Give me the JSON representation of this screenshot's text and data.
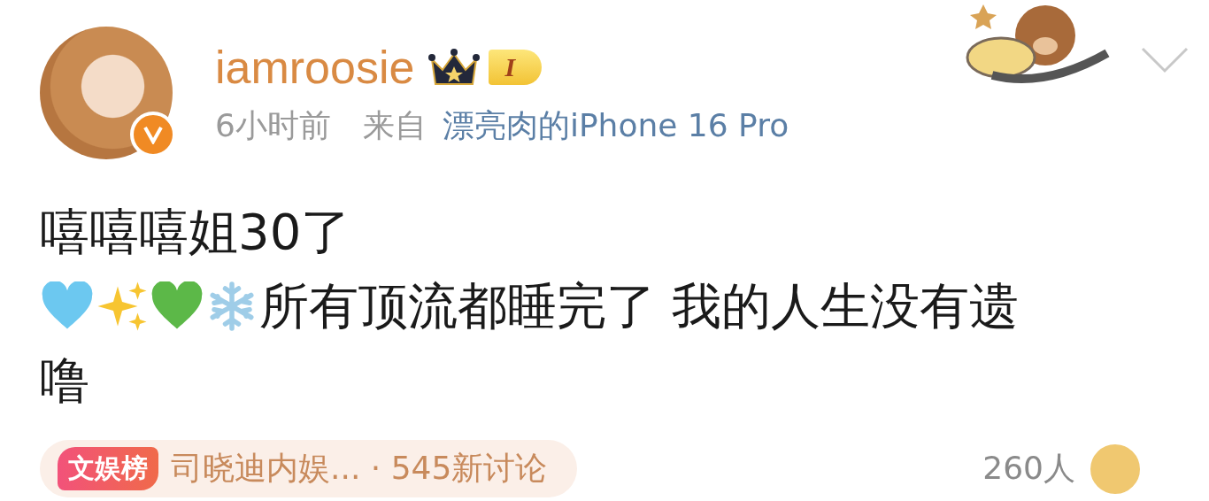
{
  "post": {
    "author": {
      "name": "iamroosie",
      "verified": true,
      "level_badge": "I"
    },
    "meta": {
      "time": "6小时前",
      "source_prefix": "来自",
      "device": "漂亮肉的iPhone 16 Pro"
    },
    "lines": [
      {
        "text": "嘻嘻嘻姐30了"
      },
      {
        "emojis": [
          {
            "kind": "blue-heart"
          },
          {
            "kind": "sparkles"
          },
          {
            "kind": "green-heart"
          },
          {
            "kind": "snowflake"
          }
        ],
        "text": "所有顶流都睡完了 我的人生没有遗"
      },
      {
        "text": "噜"
      }
    ],
    "topic": {
      "badge": "文娱榜",
      "text": "司晓迪内娱... · 545新讨论"
    },
    "viewers": "260人"
  }
}
